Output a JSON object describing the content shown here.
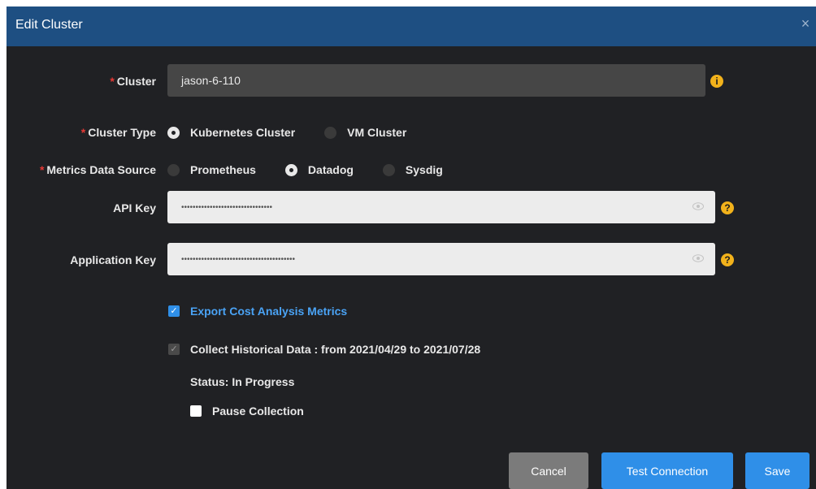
{
  "dialog": {
    "title": "Edit Cluster",
    "close_glyph": "×"
  },
  "form": {
    "required_mark": "*",
    "cluster": {
      "label": "Cluster",
      "value": "jason-6-110",
      "info_icon": "info-icon",
      "info_glyph": "i"
    },
    "cluster_type": {
      "label": "Cluster Type",
      "options": [
        "Kubernetes Cluster",
        "VM Cluster"
      ],
      "selected": "Kubernetes Cluster"
    },
    "metrics_source": {
      "label": "Metrics Data Source",
      "options": [
        "Prometheus",
        "Datadog",
        "Sysdig"
      ],
      "selected": "Datadog"
    },
    "api_key": {
      "label": "API Key",
      "value": "••••••••••••••••••••••••••••••••",
      "help_glyph": "?"
    },
    "application_key": {
      "label": "Application Key",
      "value": "••••••••••••••••••••••••••••••••••••••••",
      "help_glyph": "?"
    },
    "export_cost": {
      "label": "Export Cost Analysis Metrics",
      "checked": true
    },
    "collect_historical": {
      "label": "Collect Historical Data : from 2021/04/29 to 2021/07/28",
      "checked": true,
      "disabled": true
    },
    "status_text": "Status: In Progress",
    "pause_collection": {
      "label": "Pause Collection",
      "checked": false
    }
  },
  "buttons": {
    "cancel": "Cancel",
    "test_connection": "Test Connection",
    "save": "Save"
  },
  "colors": {
    "title_bar": "#1e4f82",
    "background": "#202124",
    "primary": "#2f8fe8",
    "required": "#e53935",
    "warning": "#f2b21b"
  }
}
